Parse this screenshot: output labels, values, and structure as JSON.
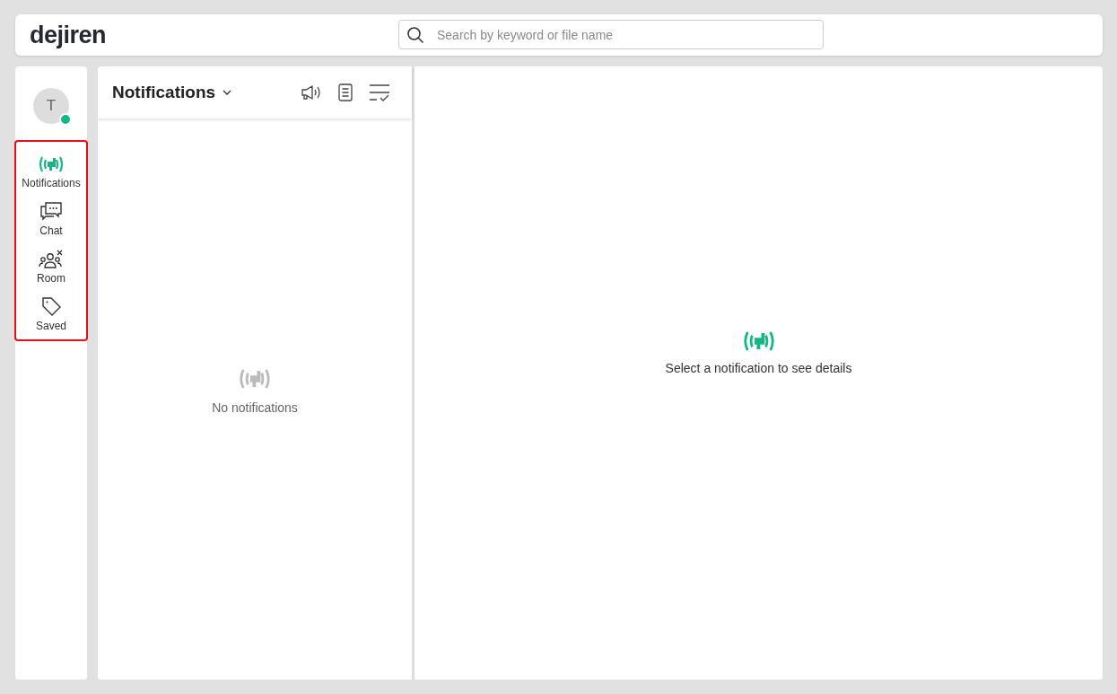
{
  "header": {
    "logo": "dejiren",
    "search": {
      "placeholder": "Search by keyword or file name"
    }
  },
  "user": {
    "initial": "T",
    "online": true
  },
  "sidebar": {
    "highlighted": true,
    "items": [
      {
        "label": "Notifications",
        "kind": "notifications",
        "selected": true
      },
      {
        "label": "Chat",
        "kind": "chat",
        "selected": false
      },
      {
        "label": "Room",
        "kind": "room",
        "selected": false
      },
      {
        "label": "Saved",
        "kind": "saved",
        "selected": false
      }
    ]
  },
  "list_panel": {
    "title": "Notifications",
    "empty_text": "No notifications"
  },
  "detail_panel": {
    "empty_text": "Select a notification to see details"
  }
}
